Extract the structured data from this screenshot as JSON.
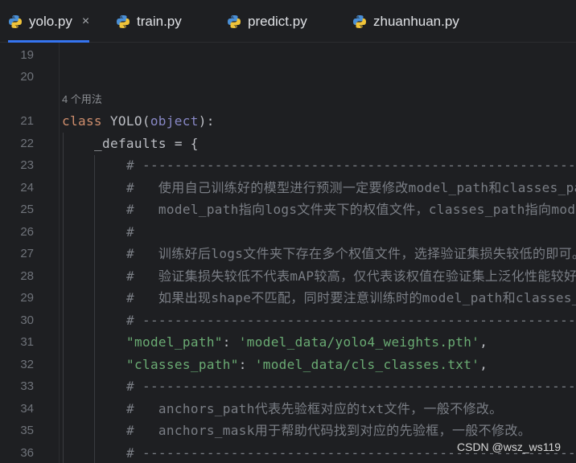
{
  "tabs": [
    {
      "label": "yolo.py",
      "active": true,
      "close": "×"
    },
    {
      "label": "train.py",
      "active": false
    },
    {
      "label": "predict.py",
      "active": false
    },
    {
      "label": "zhuanhuan.py",
      "active": false
    }
  ],
  "editor": {
    "line_numbers": [
      "19",
      "20",
      "21",
      "22",
      "23",
      "24",
      "25",
      "26",
      "27",
      "28",
      "29",
      "30",
      "31",
      "32",
      "33",
      "34",
      "35",
      "36"
    ],
    "usage_hint": "4 个用法",
    "lines": {
      "l21_kw": "class",
      "l21_name": " YOLO(",
      "l21_builtin": "object",
      "l21_end": "):",
      "l22": "_defaults = {",
      "l23": "# ----------------------------------------------------------------",
      "l24": "#   使用自己训练好的模型进行预测一定要修改model_path和classes_pa",
      "l25": "#   model_path指向logs文件夹下的权值文件，classes_path指向mode",
      "l26": "#",
      "l27": "#   训练好后logs文件夹下存在多个权值文件，选择验证集损失较低的即可。",
      "l28": "#   验证集损失较低不代表mAP较高，仅代表该权值在验证集上泛化性能较好。",
      "l29": "#   如果出现shape不匹配，同时要注意训练时的model_path和classes_",
      "l30": "# ----------------------------------------------------------------",
      "l31_key": "\"model_path\"",
      "l31_sep": ": ",
      "l31_val": "'model_data/yolo4_weights.pth'",
      "l31_end": ",",
      "l32_key": "\"classes_path\"",
      "l32_sep": ": ",
      "l32_val": "'model_data/cls_classes.txt'",
      "l32_end": ",",
      "l33": "# ----------------------------------------------------------------",
      "l34": "#   anchors_path代表先验框对应的txt文件，一般不修改。",
      "l35": "#   anchors_mask用于帮助代码找到对应的先验框，一般不修改。",
      "l36": "# ----------------------------------------------------------------"
    }
  },
  "watermark": "CSDN @wsz_ws119",
  "colors": {
    "background": "#1e1f22",
    "keyword": "#cf8e6d",
    "builtin": "#8888c6",
    "string": "#6aab73",
    "comment": "#7a7e85",
    "active_tab_underline": "#3574f0"
  }
}
